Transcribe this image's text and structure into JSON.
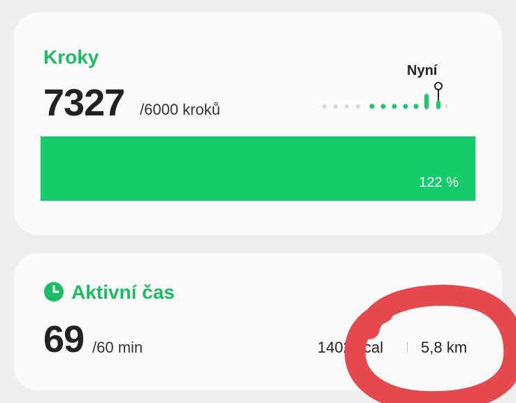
{
  "steps": {
    "title": "Kroky",
    "value": "7327",
    "goal": "/6000 kroků",
    "now_label": "Nyní",
    "progress": 1.0,
    "progress_label": "122 %"
  },
  "active": {
    "icon": "clock-icon",
    "title": "Aktivní čas",
    "value": "69",
    "goal": "/60 min",
    "calories": "1402 kcal",
    "distance": "5,8 km"
  },
  "colors": {
    "accent": "#1bbd63",
    "bar": "#14cc6a",
    "annotation": "#e5484d"
  }
}
